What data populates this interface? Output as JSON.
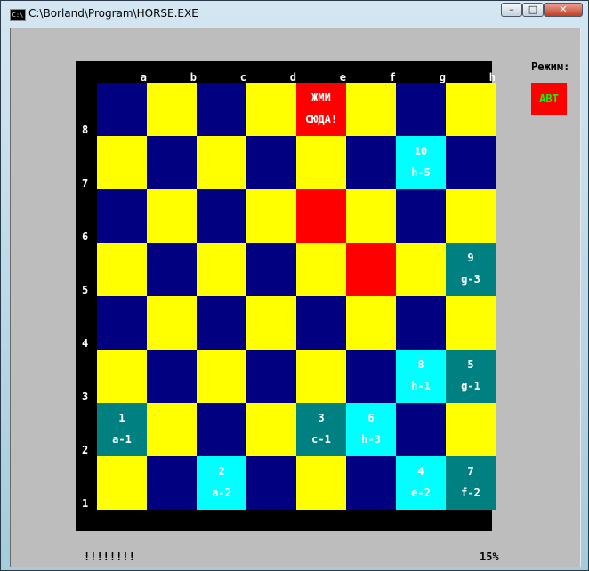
{
  "window": {
    "title": "C:\\Borland\\Program\\HORSE.EXE",
    "icon": "console-icon",
    "icon_text": "C:\\"
  },
  "board": {
    "files": [
      "a",
      "b",
      "c",
      "d",
      "e",
      "f",
      "g",
      "h"
    ],
    "ranks": [
      "8",
      "7",
      "6",
      "5",
      "4",
      "3",
      "2",
      "1"
    ],
    "colors": {
      "dark": "#000080",
      "light": "#ffff00",
      "frame": "#000000",
      "highlight_red": "#ff0000",
      "visited_teal": "#008080",
      "visited_cyan": "#00ffff"
    },
    "special_squares": [
      {
        "square": "e8",
        "color": "#ff0000",
        "line1": "ЖМИ",
        "line2": "СЮДА!"
      },
      {
        "square": "e6",
        "color": "#ff0000",
        "line1": "",
        "line2": ""
      },
      {
        "square": "f5",
        "color": "#ff0000",
        "line1": "",
        "line2": ""
      },
      {
        "square": "g7",
        "color": "#00ffff",
        "line1": "10",
        "line2": "h-5"
      },
      {
        "square": "h5",
        "color": "#008080",
        "line1": "9",
        "line2": "g-3"
      },
      {
        "square": "g3",
        "color": "#00ffff",
        "line1": "8",
        "line2": "h-1"
      },
      {
        "square": "h3",
        "color": "#008080",
        "line1": "5",
        "line2": "g-1"
      },
      {
        "square": "a2",
        "color": "#008080",
        "line1": "1",
        "line2": "a-1"
      },
      {
        "square": "e2",
        "color": "#008080",
        "line1": "3",
        "line2": "c-1"
      },
      {
        "square": "f2",
        "color": "#00ffff",
        "line1": "6",
        "line2": "h-3"
      },
      {
        "square": "c1",
        "color": "#00ffff",
        "line1": "2",
        "line2": "a-2"
      },
      {
        "square": "g1",
        "color": "#00ffff",
        "line1": "4",
        "line2": "e-2"
      },
      {
        "square": "h1",
        "color": "#008080",
        "line1": "7",
        "line2": "f-2"
      }
    ]
  },
  "mode": {
    "label": "Режим:",
    "value": "АВТ",
    "button_color": "#ff0000",
    "text_color": "#00ff00"
  },
  "status": {
    "progress_marks": "!!!!!!!!",
    "progress_percent": "15%"
  }
}
